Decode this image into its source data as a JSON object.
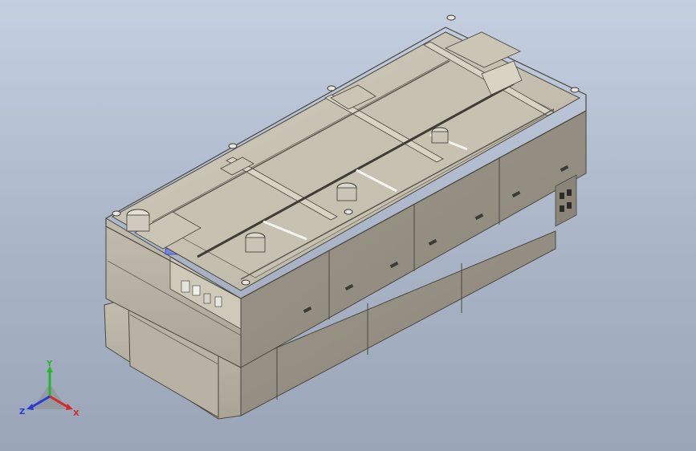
{
  "viewport": {
    "background_top": "#c4cfe0",
    "background_bottom": "#9aa6b8",
    "model_color": "#b4ae9e",
    "edge_color": "#4a473f"
  },
  "triad": {
    "x_label": "X",
    "y_label": "Y",
    "z_label": "Z",
    "x_color": "#d42a2a",
    "y_color": "#2bb52b",
    "z_color": "#2a3ad4"
  }
}
